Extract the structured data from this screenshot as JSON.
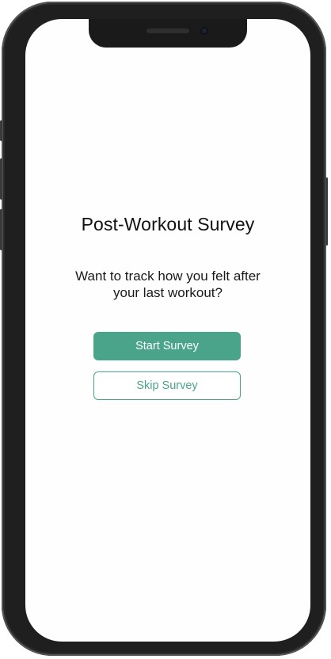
{
  "survey": {
    "title": "Post-Workout Survey",
    "prompt": "Want to track how you felt after your last workout?",
    "start_label": "Start Survey",
    "skip_label": "Skip Survey"
  },
  "colors": {
    "accent": "#4aa48a",
    "device_frame": "#1f1f1f",
    "screen_background": "#fefefe"
  }
}
